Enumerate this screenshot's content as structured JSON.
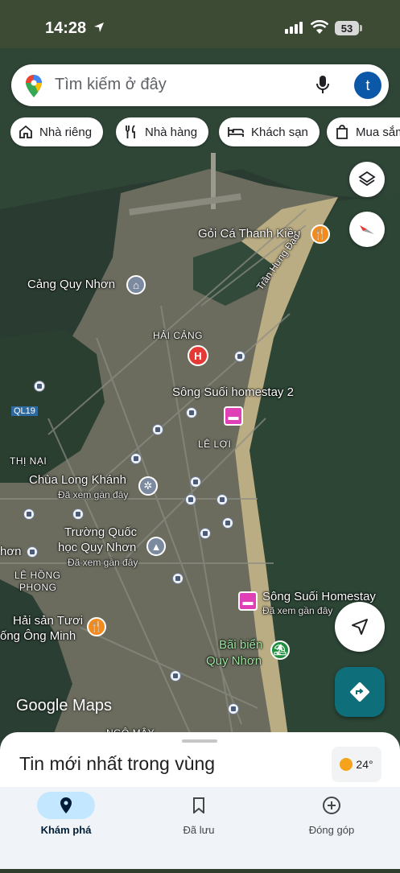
{
  "status_bar": {
    "time": "14:28",
    "battery": "53"
  },
  "search": {
    "placeholder": "Tìm kiếm ở đây",
    "avatar_letter": "t"
  },
  "chips": [
    {
      "label": "Nhà riêng",
      "icon": "home-icon"
    },
    {
      "label": "Nhà hàng",
      "icon": "restaurant-icon"
    },
    {
      "label": "Khách sạn",
      "icon": "hotel-icon"
    },
    {
      "label": "Mua sắm",
      "icon": "shopping-bag-icon"
    }
  ],
  "map": {
    "places": {
      "goi_ca": "Gỏi Cá Thanh Kiều",
      "cang": "Cảng Quy Nhơn",
      "song_suoi_2": "Sông Suối homestay 2",
      "chua": "Chùa Long Khánh",
      "truong_1": "Trường Quốc",
      "truong_2": "học Quy Nhơn",
      "song_suoi": "Sông Suối Homestay",
      "hai_san_1": "Hải sản Tươi",
      "hai_san_2": "ống Ông Minh",
      "bai_bien_1": "Bãi biển",
      "bai_bien_2": "Quy Nhơn"
    },
    "seen_recently": "Đã xem gần đây",
    "areas": {
      "hai_cang": "HẢI CẢNG",
      "le_loi": "LÊ LỢI",
      "thi_nai": "THỊ NẠI",
      "le_hong_phong_1": "LÊ HỒNG",
      "le_hong_phong_2": "PHONG",
      "ngo_may": "NGÔ MÂY",
      "nhon": "hơn"
    },
    "roads": {
      "tran_hung_dao": "Trần Hưng Đạo",
      "ql19": "QL19"
    },
    "logo": "Google Maps"
  },
  "sheet": {
    "title": "Tin mới nhất trong vùng",
    "temperature": "24°"
  },
  "nav": [
    {
      "label": "Khám phá",
      "icon": "explore-pin-icon",
      "active": true
    },
    {
      "label": "Đã lưu",
      "icon": "bookmark-icon",
      "active": false
    },
    {
      "label": "Đóng góp",
      "icon": "add-circle-icon",
      "active": false
    }
  ],
  "colors": {
    "accent": "#0e6f7a",
    "nav_active": "#c2e7ff",
    "avatar": "#0b57a8"
  }
}
